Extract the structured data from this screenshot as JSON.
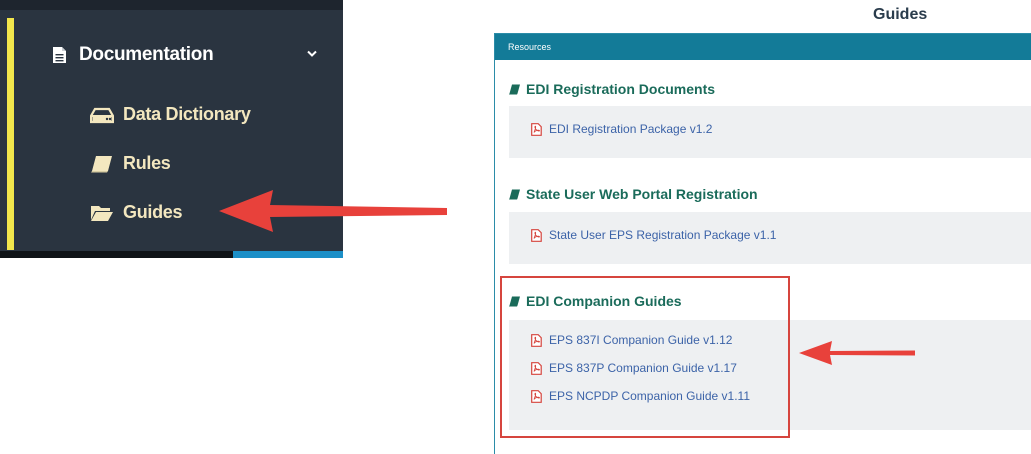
{
  "sidebar": {
    "documentation": {
      "label": "Documentation",
      "icon": "file-icon"
    },
    "items": [
      {
        "label": "Data Dictionary",
        "icon": "hard-drive-icon"
      },
      {
        "label": "Rules",
        "icon": "book-icon"
      },
      {
        "label": "Guides",
        "icon": "folder-open-icon"
      }
    ]
  },
  "page": {
    "title": "Guides"
  },
  "panel": {
    "header": "Resources",
    "sections": [
      {
        "title": "EDI Registration Documents",
        "links": [
          "EDI Registration Package v1.2"
        ]
      },
      {
        "title": "State User Web Portal Registration",
        "links": [
          "State User EPS Registration Package v1.1"
        ]
      },
      {
        "title": "EDI Companion Guides",
        "links": [
          "EPS 837I Companion Guide v1.12",
          "EPS 837P Companion Guide v1.17",
          "EPS NCPDP Companion Guide v1.11"
        ]
      }
    ]
  },
  "colors": {
    "sidebar_bg": "#2a3440",
    "sidebar_accent": "#f2e64c",
    "panel_header": "#137b98",
    "section_title": "#1a6b5a",
    "link": "#3c63a8",
    "pdf_icon": "#d6453e",
    "annotation_arrow": "#e8413b"
  }
}
